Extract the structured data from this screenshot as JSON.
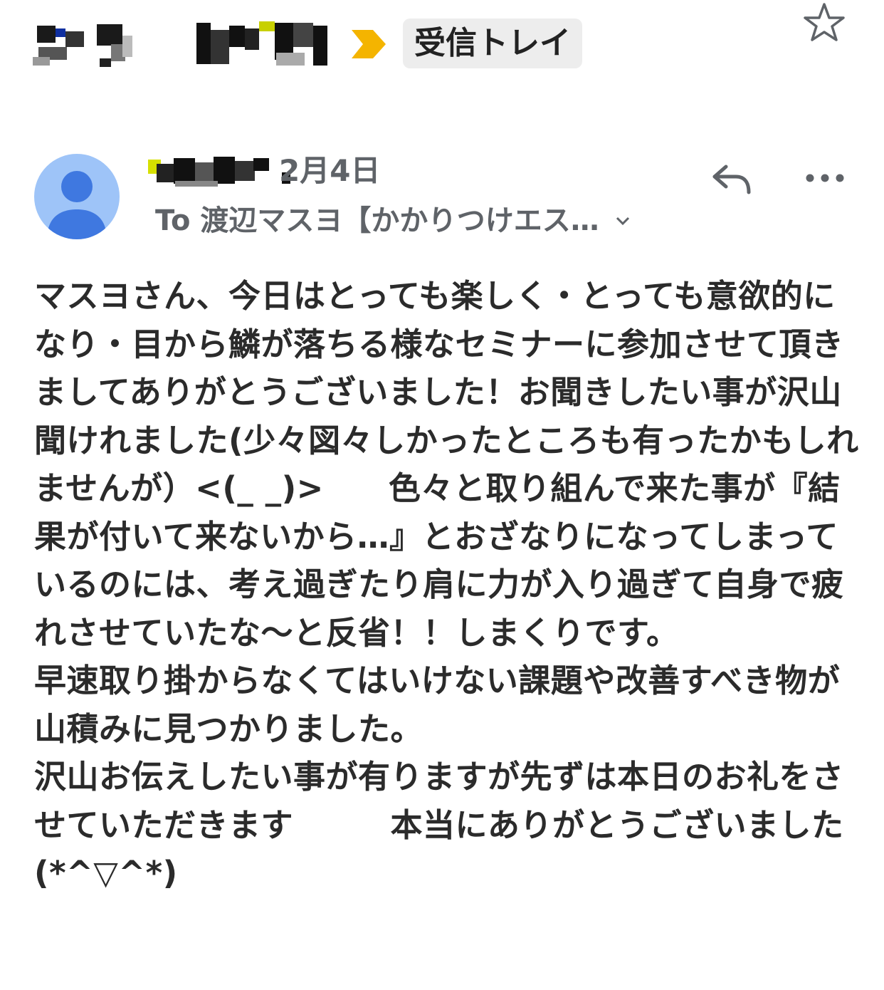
{
  "header": {
    "label_chip": "受信トレイ",
    "icons": {
      "importance": "importance-marker-icon",
      "star": "star-icon"
    },
    "colors": {
      "importance": "#f4b400",
      "chip_bg": "#ededed"
    }
  },
  "message": {
    "date": "2月4日",
    "recipient": "To 渡辺マスヨ【かかりつけエス…",
    "avatar_color": "#9ec4f8",
    "icons": {
      "reply": "reply-icon",
      "more": "more-dots-icon",
      "expand": "chevron-down-icon"
    },
    "body": "マスヨさん、今日はとっても楽しく・とっても意欲的になり・目から鱗が落ちる様なセミナーに参加させて頂きましてありがとうございました！お聞きしたい事が沢山聞けれました(少々図々しかったところも有ったかもしれませんが）<(_ _)>　　色々と取り組んで来た事が『結果が付いて来ないから…』とおざなりになってしまっているのには、考え過ぎたり肩に力が入り過ぎて自身で疲れさせていたな〜と反省！！しまくりです。\n早速取り掛からなくてはいけない課題や改善すべき物が山積みに見つかりました。\n沢山お伝えしたい事が有りますが先ずは本日のお礼をさせていただきます　　　本当にありがとうございました(*^▽^*)"
  }
}
